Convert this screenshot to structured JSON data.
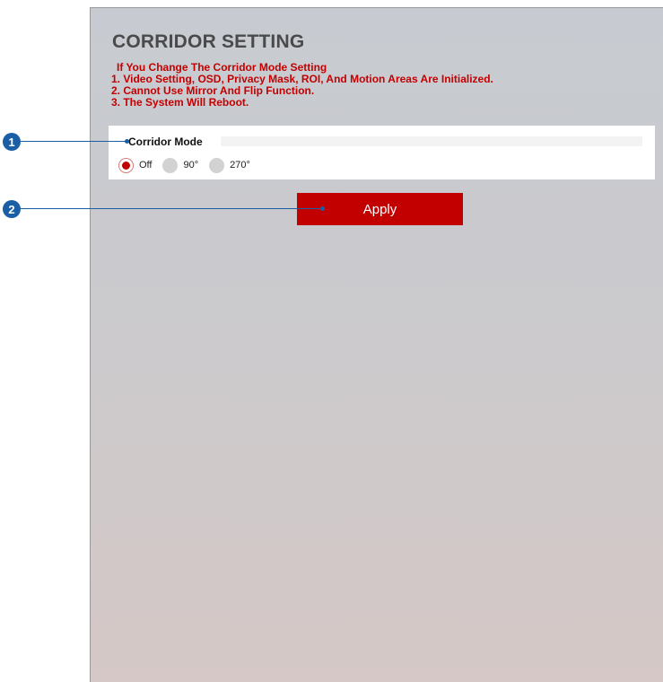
{
  "page": {
    "title": "CORRIDOR SETTING",
    "warnings": [
      "If You Change The Corridor Mode Setting",
      "1. Video Setting, OSD, Privacy Mask, ROI, And Motion Areas Are Initialized.",
      "2. Cannot Use Mirror And Flip Function.",
      "3. The System Will Reboot."
    ]
  },
  "corridor_mode": {
    "label": "Corridor Mode",
    "options": [
      {
        "label": "Off",
        "selected": true
      },
      {
        "label": "90°",
        "selected": false
      },
      {
        "label": "270°",
        "selected": false
      }
    ]
  },
  "apply_button": {
    "label": "Apply"
  },
  "callouts": [
    {
      "number": "1"
    },
    {
      "number": "2"
    }
  ],
  "colors": {
    "accent": "#c20000",
    "warning_text": "#c40000",
    "callout": "#1a5fa6"
  }
}
